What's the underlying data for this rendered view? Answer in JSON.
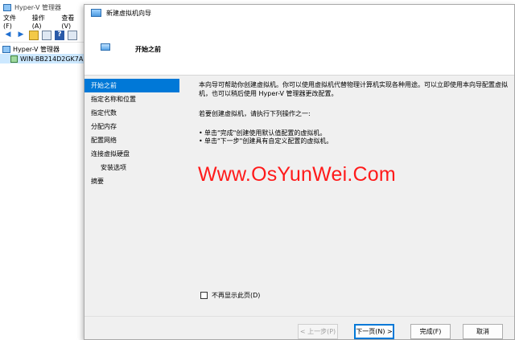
{
  "manager": {
    "title": "Hyper-V 管理器",
    "menu": [
      "文件(F)",
      "操作(A)",
      "查看(V)"
    ],
    "tree_root": "Hyper-V 管理器",
    "tree_server": "WIN-BB214D2GK7A"
  },
  "wizard": {
    "title": "新建虚拟机向导",
    "heading": "开始之前",
    "nav": [
      "开始之前",
      "指定名称和位置",
      "指定代数",
      "分配内存",
      "配置网络",
      "连接虚拟硬盘",
      "安装选项",
      "摘要"
    ],
    "intro": "本向导可帮助你创建虚拟机。你可以使用虚拟机代替物理计算机实现各种用途。可以立即使用本向导配置虚拟机，也可以稍后使用 Hyper-V 管理器更改配置。",
    "prompt": "若要创建虚拟机，请执行下列操作之一:",
    "bullets": [
      "单击\"完成\"创建使用默认值配置的虚拟机。",
      "单击\"下一步\"创建具有自定义配置的虚拟机。"
    ],
    "dont_show": "不再显示此页(D)",
    "buttons": {
      "prev": "< 上一步(P)",
      "next": "下一页(N) >",
      "finish": "完成(F)",
      "cancel": "取消"
    }
  },
  "watermark": "Www.OsYunWei.Com"
}
